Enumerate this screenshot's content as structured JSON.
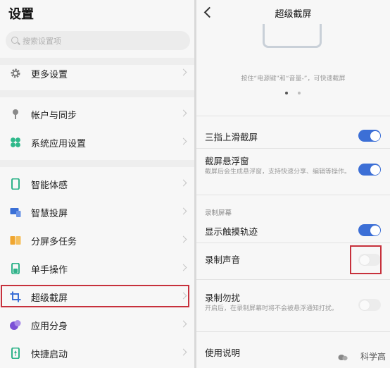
{
  "left": {
    "title": "设置",
    "search_placeholder": "搜索设置项",
    "items": [
      {
        "label": "更多设置",
        "icon": "gear-icon"
      },
      {
        "label": "帐户与同步",
        "icon": "account-pin-icon"
      },
      {
        "label": "系统应用设置",
        "icon": "apps-icon"
      },
      {
        "label": "智能体感",
        "icon": "phone-sense-icon"
      },
      {
        "label": "智慧投屏",
        "icon": "cast-screen-icon"
      },
      {
        "label": "分屏多任务",
        "icon": "split-screen-icon"
      },
      {
        "label": "单手操作",
        "icon": "one-hand-icon"
      },
      {
        "label": "超级截屏",
        "icon": "crop-icon"
      },
      {
        "label": "应用分身",
        "icon": "clone-app-icon"
      },
      {
        "label": "快捷启动",
        "icon": "quick-launch-icon"
      }
    ]
  },
  "right": {
    "title": "超级截屏",
    "hint": "按住“电源键”和“音量-”，可快速截屏",
    "rows": [
      {
        "title": "三指上滑截屏",
        "desc": "",
        "on": true
      },
      {
        "title": "截屏悬浮窗",
        "desc": "截屏后会生成悬浮窗，支持快速分享、编辑等操作。",
        "on": true
      },
      {
        "title": "显示触摸轨迹",
        "desc": "",
        "on": true
      },
      {
        "title": "录制声音",
        "desc": "",
        "on": false
      },
      {
        "title": "录制勿扰",
        "desc": "开启后，在录制屏幕时将不会被悬浮通知打扰。",
        "on": false
      }
    ],
    "section_label": "录制屏幕",
    "help": "使用说明"
  },
  "watermark": "科学高",
  "colors": {
    "accent": "#3c6fd6",
    "highlight": "#c7313c"
  }
}
